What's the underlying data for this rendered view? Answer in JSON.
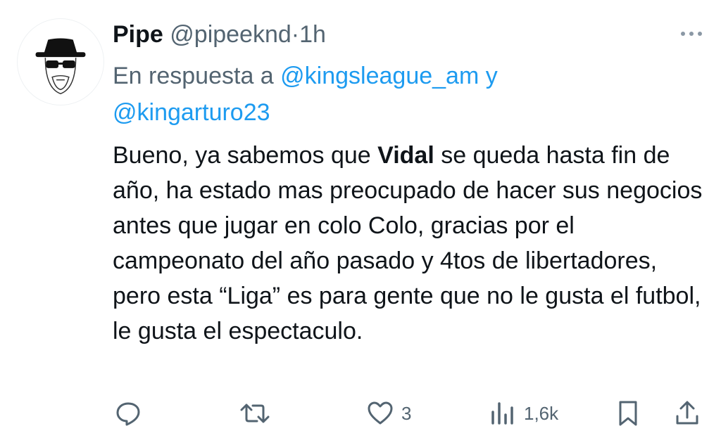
{
  "tweet": {
    "author_name": "Pipe",
    "author_handle": "@pipeeknd",
    "separator": "·",
    "time": "1h",
    "reply_prefix": "En respuesta a",
    "mention_1": "@kingsleague_am",
    "mention_joiner": "y",
    "mention_2": "@kingarturo23",
    "text_part1": "Bueno, ya sabemos que ",
    "text_bold": "Vidal",
    "text_part2": " se queda hasta fin de año, ha estado mas preocupado de hacer sus negocios antes que jugar en colo Colo, gracias por el campeonato del año pasado y 4tos de libertadores, pero esta “Liga” es para gente que no le gusta el futbol, le gusta el espectaculo."
  },
  "actions": {
    "likes": "3",
    "views": "1,6k"
  },
  "colors": {
    "text": "#0f1419",
    "secondary": "#536471",
    "link": "#1d9bf0"
  },
  "icons": [
    "more-icon",
    "reply-icon",
    "retweet-icon",
    "like-icon",
    "views-icon",
    "bookmark-icon",
    "share-icon"
  ]
}
